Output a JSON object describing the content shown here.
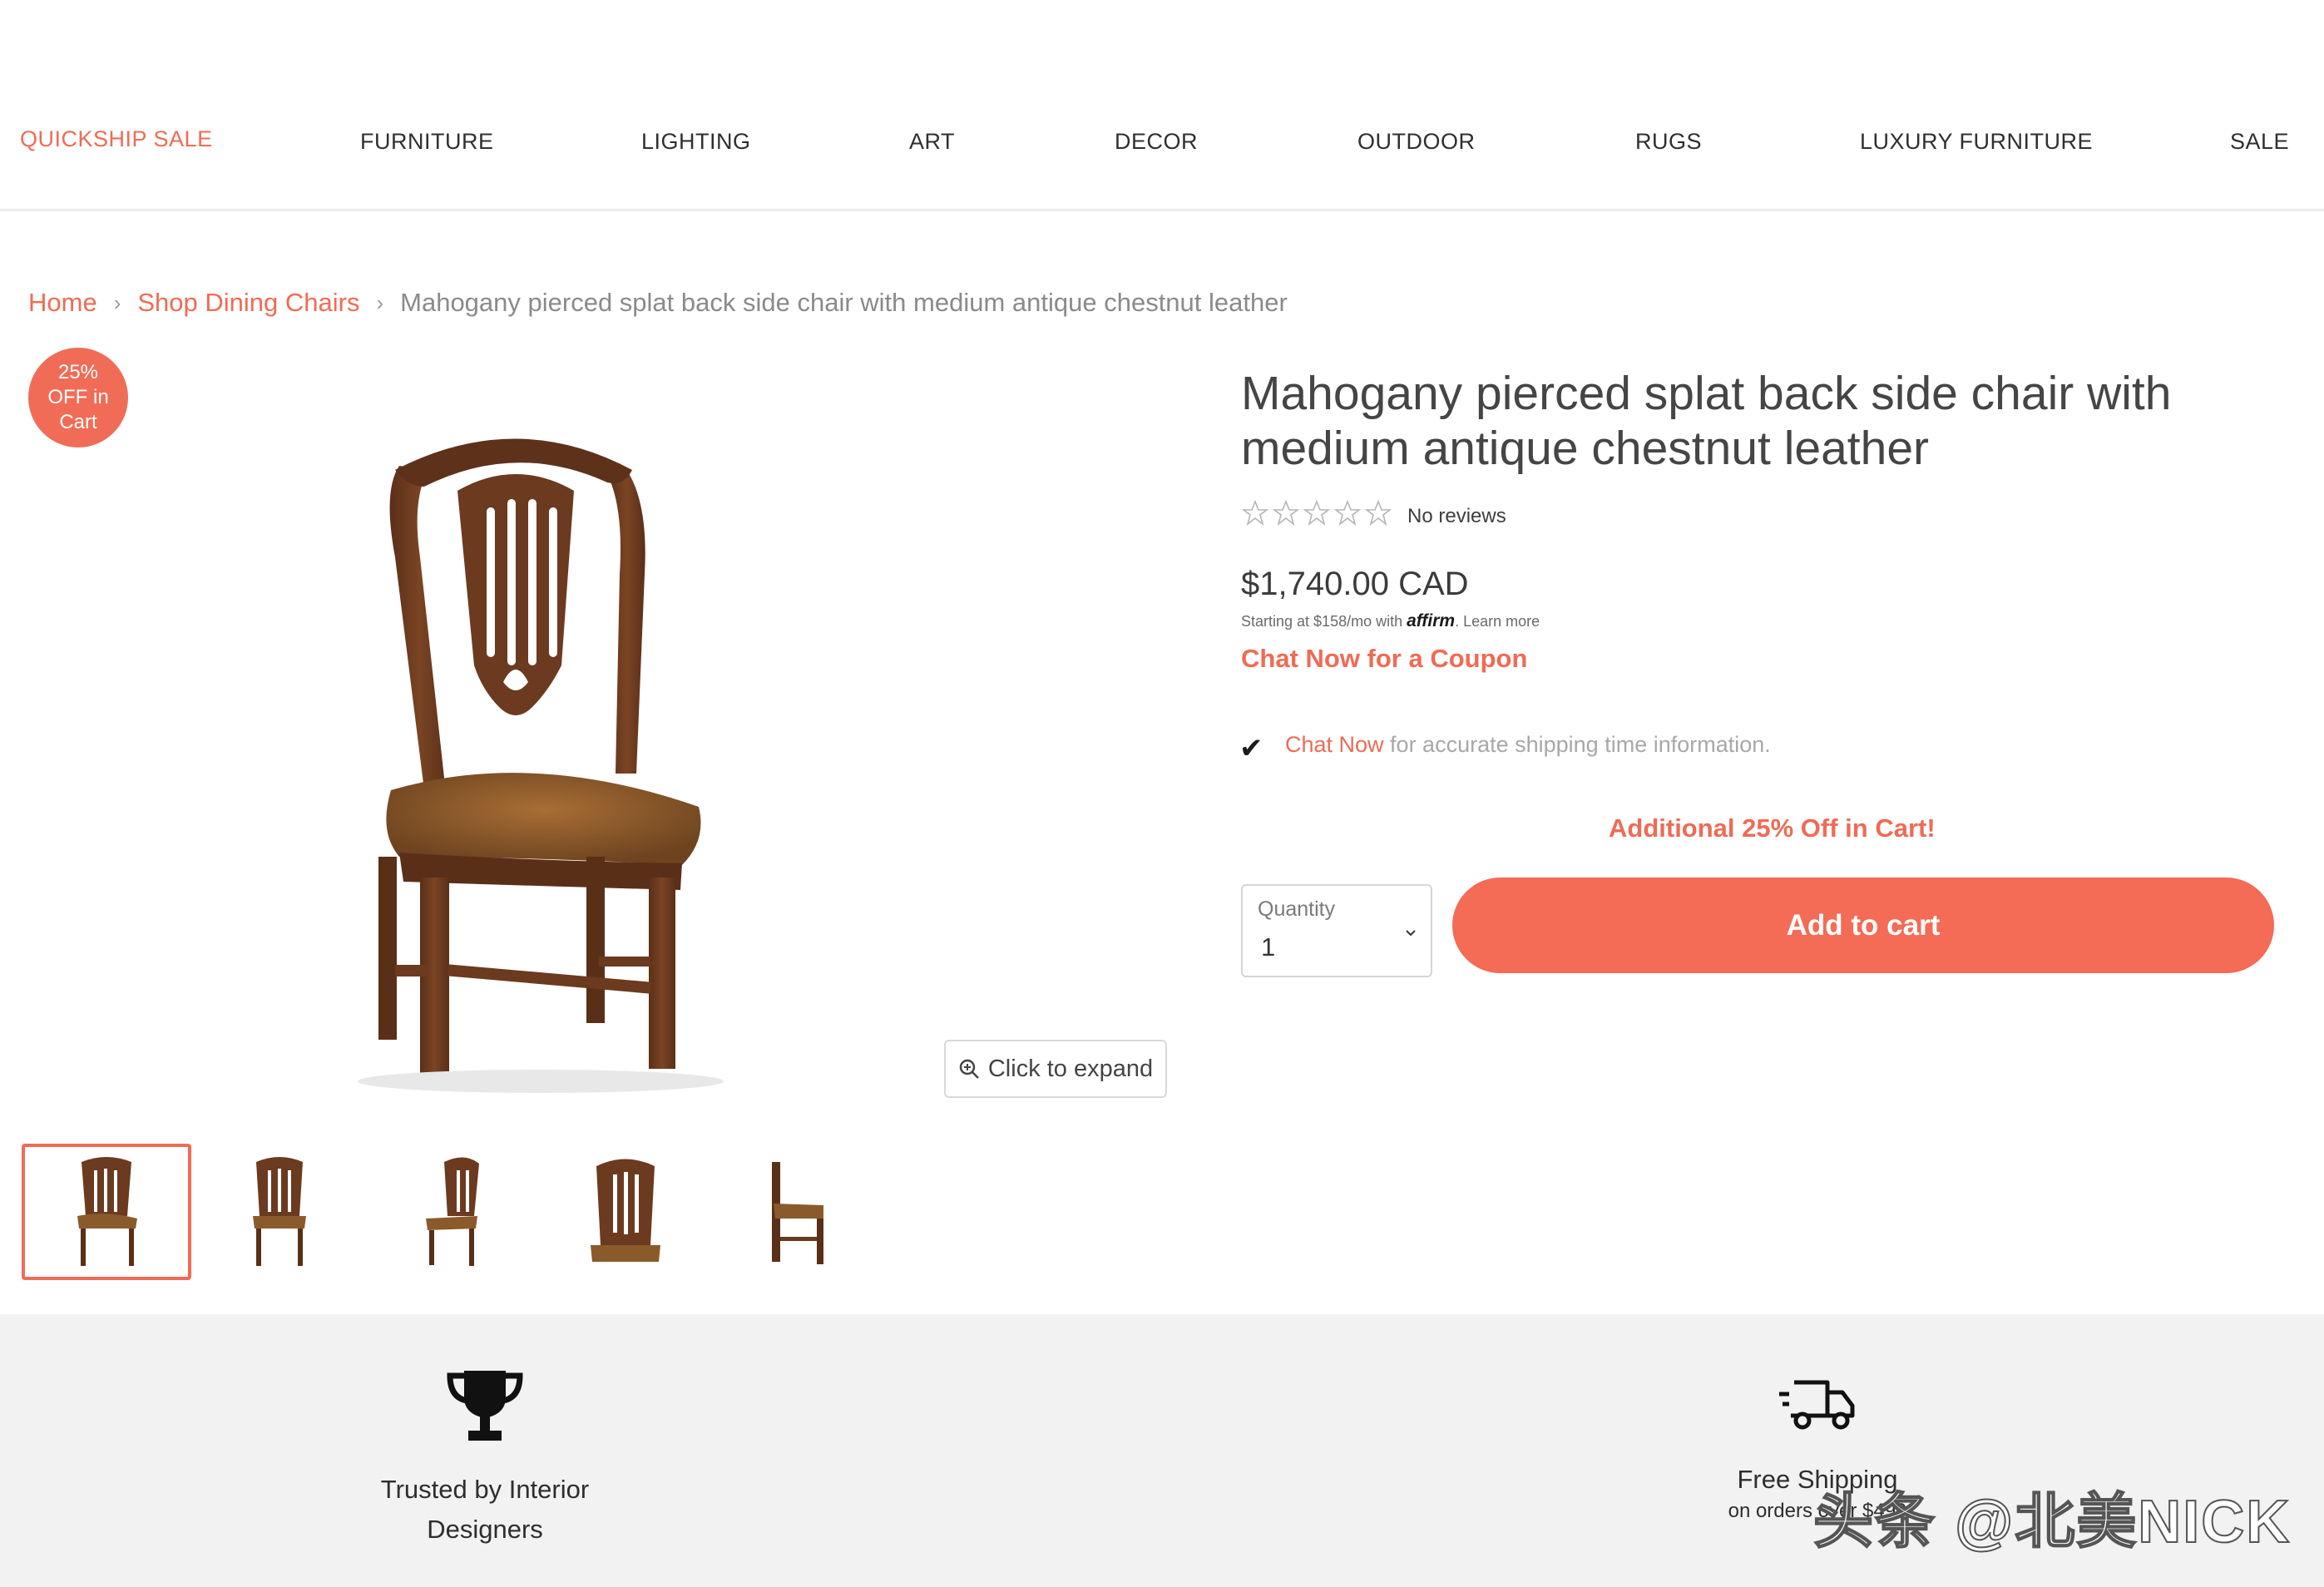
{
  "nav": {
    "items": [
      {
        "label": "QUICKSHIP SALE",
        "accent": true
      },
      {
        "label": "FURNITURE"
      },
      {
        "label": "LIGHTING"
      },
      {
        "label": "ART"
      },
      {
        "label": "DECOR"
      },
      {
        "label": "OUTDOOR"
      },
      {
        "label": "RUGS"
      },
      {
        "label": "LUXURY FURNITURE"
      },
      {
        "label": "SALE"
      }
    ]
  },
  "breadcrumb": {
    "home": "Home",
    "category": "Shop Dining Chairs",
    "current": "Mahogany pierced splat back side chair with medium antique chestnut leather"
  },
  "badge": {
    "text": "25% OFF in Cart"
  },
  "gallery": {
    "expand_label": "Click to expand",
    "thumbnail_count": 5,
    "active_thumbnail": 1
  },
  "product": {
    "title": "Mahogany pierced splat back side chair with medium antique chestnut leather",
    "rating": 0,
    "reviews_label": "No reviews",
    "price": "$1,740.00 CAD",
    "affirm_prefix": "Starting at $158/mo with",
    "affirm_logo": "affirm",
    "affirm_learn": ". Learn more",
    "coupon_label": "Chat Now for a Coupon",
    "shipping_check": "✔",
    "shipping_link": "Chat Now",
    "shipping_text": " for accurate shipping time information.",
    "promo_text": "Additional 25% Off in Cart!",
    "quantity_label": "Quantity",
    "quantity_value": "1",
    "add_to_cart": "Add to cart"
  },
  "features": {
    "trusted_line1": "Trusted by Interior",
    "trusted_line2": "Designers",
    "shipping_title": "Free Shipping",
    "shipping_sub": "on orders over $499"
  },
  "watermark": "头条 @北美NICK",
  "colors": {
    "accent": "#ef6b55",
    "button": "#f46b56",
    "band": "#f2f2f2",
    "wood": "#6b3a1f",
    "leather": "#8a5a2b"
  }
}
